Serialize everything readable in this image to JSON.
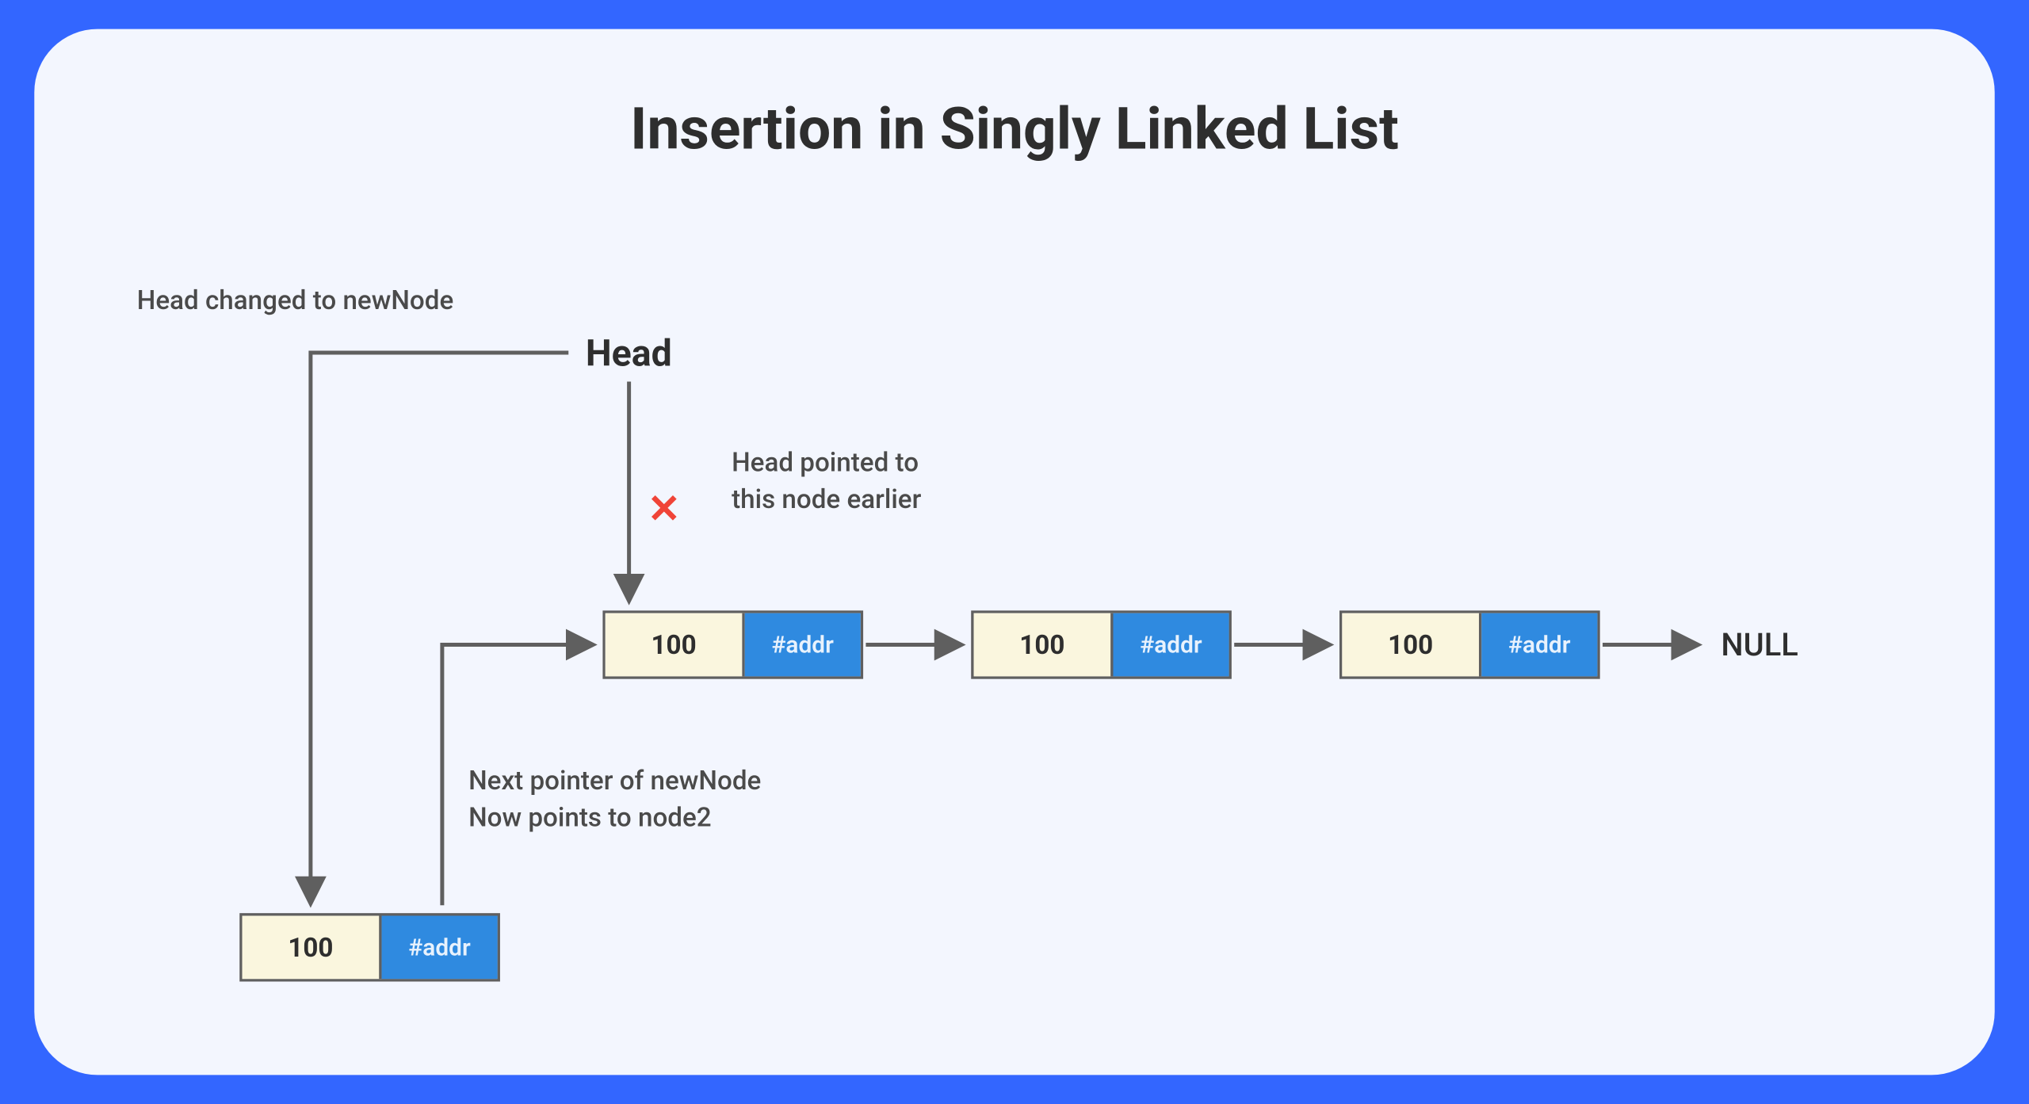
{
  "title": "Insertion in Singly Linked List",
  "headLabel": "Head",
  "nullLabel": "NULL",
  "labels": {
    "headChanged": "Head changed to newNode",
    "headPointed_line1": "Head pointed to",
    "headPointed_line2": "this node earlier",
    "nextPointer_line1": "Next pointer of newNode",
    "nextPointer_line2": "Now points to node2"
  },
  "nodes": {
    "n1": {
      "data": "100",
      "addr": "#addr"
    },
    "n2": {
      "data": "100",
      "addr": "#addr"
    },
    "n3": {
      "data": "100",
      "addr": "#addr"
    },
    "newNode": {
      "data": "100",
      "addr": "#addr"
    }
  },
  "xMark": "✕",
  "colors": {
    "pageBg": "#3366FF",
    "cardBg": "#F3F6FE",
    "nodeData": "#FAF6DE",
    "nodeAddr": "#2F8AE0",
    "arrow": "#5f5f5f",
    "xMark": "#F04438"
  }
}
